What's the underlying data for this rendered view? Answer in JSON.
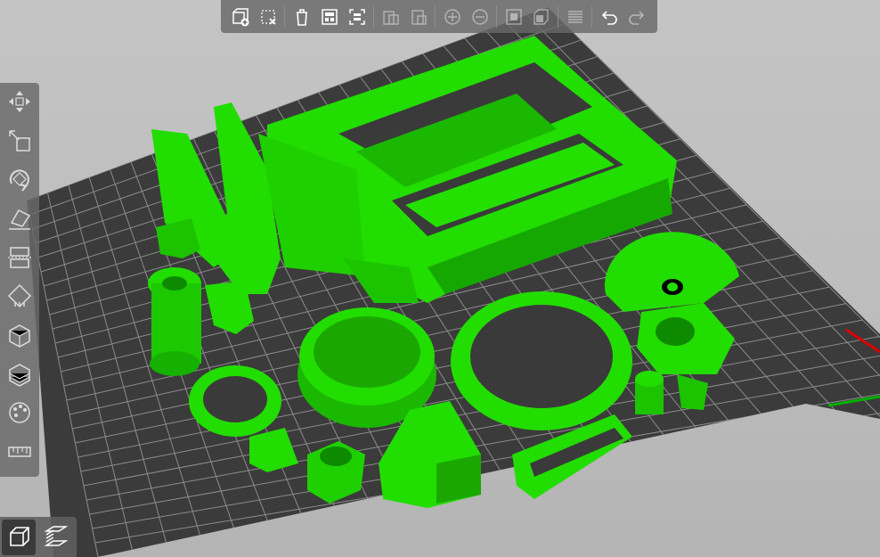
{
  "app": {
    "window_title": ""
  },
  "colors": {
    "background": "#bfbfbf",
    "bed_surface": "#3a3a3a",
    "bed_grid": "#8a8a8a",
    "model_green": "#22e000",
    "model_dark_green": "#13a000",
    "toolbar_bg": "#696969",
    "icon_color": "#ffffff",
    "axis_x": "#e00000",
    "axis_y": "#00b000"
  },
  "top_toolbar": {
    "buttons": [
      {
        "icon": "add-object-icon",
        "enabled": true
      },
      {
        "icon": "delete-icon",
        "enabled": true
      },
      {
        "icon": "delete-all-icon",
        "enabled": true
      },
      {
        "icon": "arrange-icon",
        "enabled": true
      },
      {
        "icon": "arrange-selection-icon",
        "enabled": true
      },
      {
        "icon": "copy-icon",
        "enabled": false
      },
      {
        "icon": "paste-icon",
        "enabled": false
      },
      {
        "icon": "add-instance-icon",
        "enabled": false
      },
      {
        "icon": "remove-instance-icon",
        "enabled": false
      },
      {
        "icon": "split-objects-icon",
        "enabled": false
      },
      {
        "icon": "split-parts-icon",
        "enabled": false
      },
      {
        "icon": "layers-editing-icon",
        "enabled": false
      },
      {
        "icon": "undo-icon",
        "enabled": true
      },
      {
        "icon": "redo-icon",
        "enabled": false
      }
    ]
  },
  "left_toolbar": {
    "tools": [
      {
        "icon": "move-icon"
      },
      {
        "icon": "scale-icon"
      },
      {
        "icon": "rotate-icon"
      },
      {
        "icon": "place-on-face-icon"
      },
      {
        "icon": "cut-icon"
      },
      {
        "icon": "support-paint-icon"
      },
      {
        "icon": "seam-paint-icon"
      },
      {
        "icon": "fdm-support-icon"
      },
      {
        "icon": "multimaterial-paint-icon"
      },
      {
        "icon": "measure-icon"
      }
    ]
  },
  "view_toggle": {
    "buttons": [
      {
        "icon": "3d-view-icon",
        "active": true
      },
      {
        "icon": "preview-layers-icon",
        "active": false
      }
    ]
  }
}
